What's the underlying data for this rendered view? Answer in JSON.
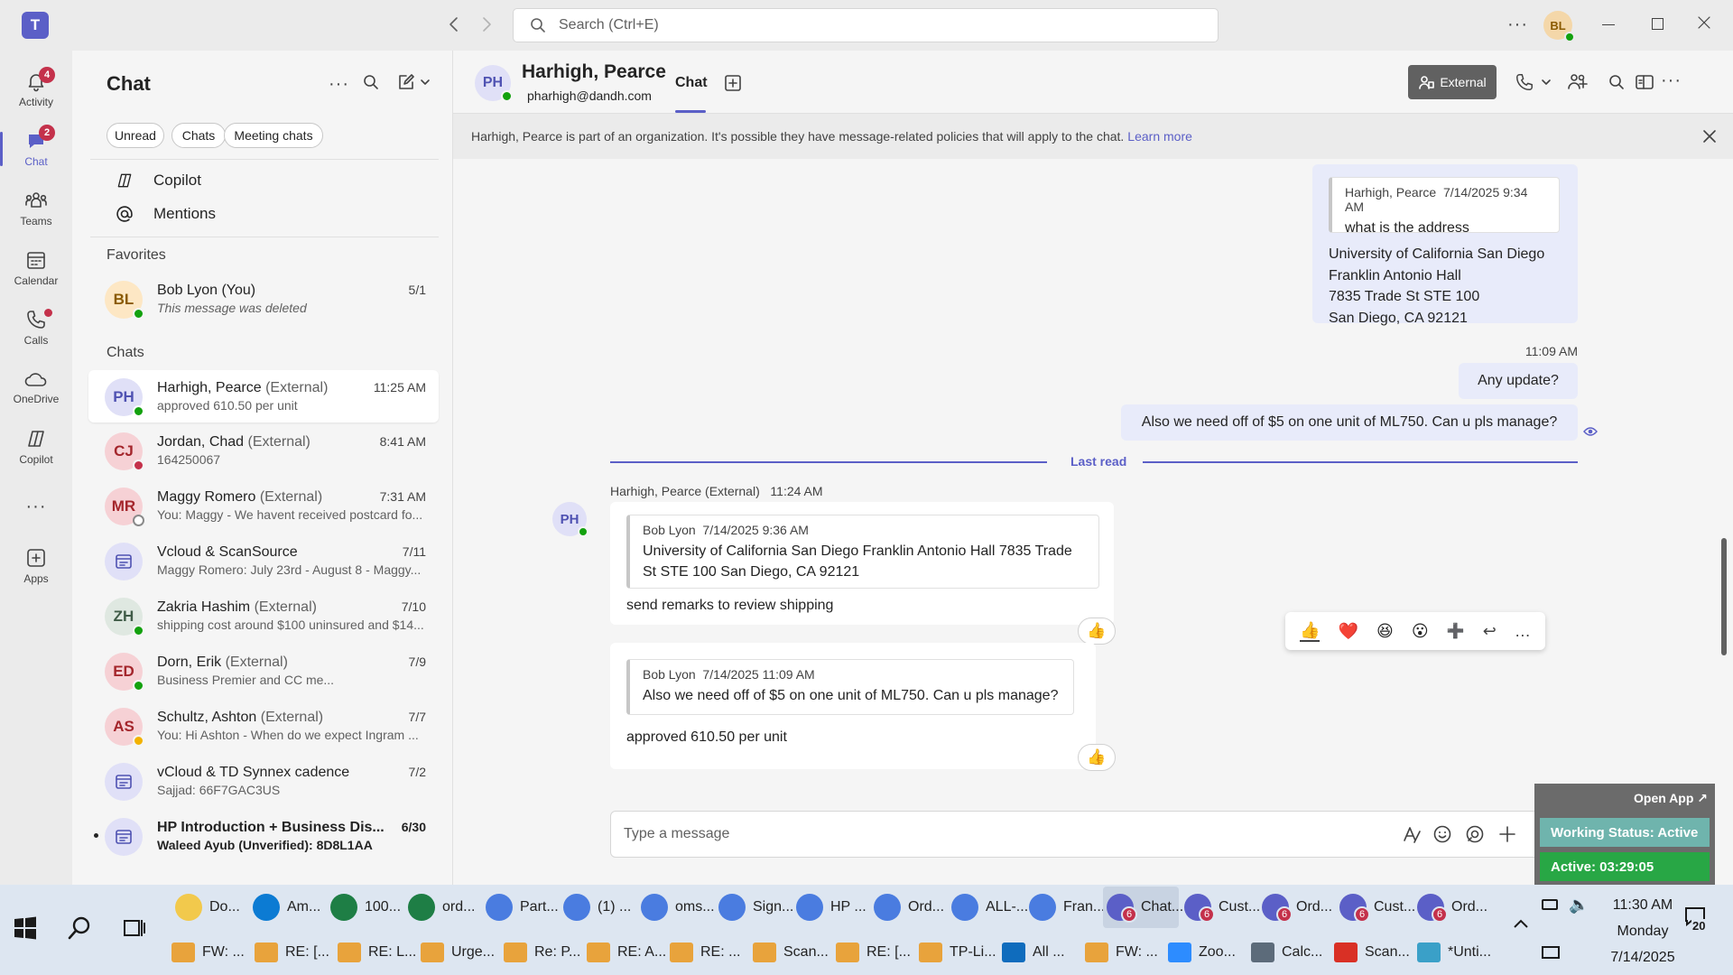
{
  "titlebar": {
    "search_placeholder": "Search (Ctrl+E)",
    "user_initials": "BL"
  },
  "rail": [
    {
      "label": "Activity",
      "badge": "4"
    },
    {
      "label": "Chat",
      "badge": "2"
    },
    {
      "label": "Teams"
    },
    {
      "label": "Calendar"
    },
    {
      "label": "Calls"
    },
    {
      "label": "OneDrive"
    },
    {
      "label": "Copilot"
    },
    {
      "label": "Apps"
    }
  ],
  "chatlist": {
    "title": "Chat",
    "filters": [
      "Unread",
      "Chats",
      "Meeting chats"
    ],
    "nav": [
      "Copilot",
      "Mentions"
    ],
    "favorites_label": "Favorites",
    "chats_label": "Chats",
    "favorites": [
      {
        "initials": "BL",
        "name": "Bob Lyon (You)",
        "external": "",
        "preview": "This message was deleted",
        "time": "5/1"
      }
    ],
    "chats": [
      {
        "initials": "PH",
        "name": "Harhigh, Pearce",
        "external": "(External)",
        "preview": "approved 610.50 per unit",
        "time": "11:25 AM"
      },
      {
        "initials": "CJ",
        "name": "Jordan, Chad",
        "external": "(External)",
        "preview": "164250067",
        "time": "8:41 AM"
      },
      {
        "initials": "MR",
        "name": "Maggy Romero",
        "external": "(External)",
        "preview": "You: Maggy - We havent received postcard fo...",
        "time": "7:31 AM"
      },
      {
        "initials": "",
        "name": "Vcloud & ScanSource",
        "external": "",
        "preview": "Maggy Romero: July 23rd - August 8 - Maggy...",
        "time": "7/11"
      },
      {
        "initials": "ZH",
        "name": "Zakria Hashim",
        "external": "(External)",
        "preview": "shipping cost around $100 uninsured and $14...",
        "time": "7/10"
      },
      {
        "initials": "ED",
        "name": "Dorn, Erik",
        "external": "(External)",
        "preview": "Business Premier and CC me...",
        "time": "7/9"
      },
      {
        "initials": "AS",
        "name": "Schultz, Ashton",
        "external": "(External)",
        "preview": "You: Hi Ashton -  When do we expect Ingram ...",
        "time": "7/7"
      },
      {
        "initials": "",
        "name": "vCloud & TD Synnex cadence",
        "external": "",
        "preview": "Sajjad: 66F7GAC3US",
        "time": "7/2"
      },
      {
        "initials": "",
        "name": "HP Introduction + Business Dis...",
        "external": "",
        "preview": "Waleed Ayub (Unverified): 8D8L1AA",
        "time": "6/30"
      }
    ]
  },
  "header": {
    "initials": "PH",
    "name": "Harhigh, Pearce",
    "email": "pharhigh@dandh.com",
    "tab": "Chat",
    "external_btn": "External"
  },
  "banner": {
    "text": "Harhigh, Pearce is part of an organization. It's possible they have message-related policies that will apply to the chat.",
    "link": "Learn more"
  },
  "messages": {
    "m1": {
      "quote_author": "Harhigh, Pearce",
      "quote_time": "7/14/2025 9:34 AM",
      "quote_text": "what is the address",
      "lines": [
        "University of California San Diego",
        "Franklin Antonio Hall",
        "7835 Trade St STE 100",
        "San Diego, CA 92121"
      ]
    },
    "m2_time": "11:09 AM",
    "m2": "Any update?",
    "m3": "Also we need off of $5 on one unit of ML750. Can u pls manage?",
    "last_read": "Last read",
    "in_header": "Harhigh, Pearce (External)   11:24 AM",
    "in_initials": "PH",
    "in1": {
      "quote_author": "Bob Lyon",
      "quote_time": "7/14/2025 9:36 AM",
      "quote_text": "University of California San Diego Franklin Antonio Hall 7835 Trade St STE 100 San Diego, CA 92121",
      "text": "send remarks to review shipping",
      "reaction": "👍"
    },
    "in2": {
      "quote_author": "Bob Lyon",
      "quote_time": "7/14/2025 11:09 AM",
      "quote_text": "Also we need off of $5 on one unit of ML750. Can u pls manage?",
      "text": "approved 610.50 per unit",
      "reaction": "👍"
    },
    "reaction_bar": [
      "👍",
      "❤️",
      "😆",
      "😮",
      "➕",
      "↩",
      "…"
    ]
  },
  "composer": {
    "placeholder": "Type a message"
  },
  "widget": {
    "open_app": "Open App ↗",
    "status": "Working Status: Active",
    "active": "Active: 03:29:05"
  },
  "taskbar": {
    "row1": [
      {
        "label": "Do...",
        "color": "#f2c94c",
        "num": ""
      },
      {
        "label": "Am...",
        "color": "#0c7bd3",
        "num": ""
      },
      {
        "label": "100...",
        "color": "#1e7e45",
        "num": ""
      },
      {
        "label": "ord...",
        "color": "#1e7e45",
        "num": ""
      },
      {
        "label": "Part...",
        "color": "#4a7ce0",
        "num": ""
      },
      {
        "label": "(1) ...",
        "color": "#4a7ce0",
        "num": ""
      },
      {
        "label": "oms...",
        "color": "#4a7ce0",
        "num": ""
      },
      {
        "label": "Sign...",
        "color": "#4a7ce0",
        "num": ""
      },
      {
        "label": "HP ...",
        "color": "#4a7ce0",
        "num": ""
      },
      {
        "label": "Ord...",
        "color": "#4a7ce0",
        "num": ""
      },
      {
        "label": "ALL-...",
        "color": "#4a7ce0",
        "num": ""
      },
      {
        "label": "Fran...",
        "color": "#4a7ce0",
        "num": ""
      },
      {
        "label": "Chat...",
        "color": "#5b5fc7",
        "num": "6"
      },
      {
        "label": "Cust...",
        "color": "#5b5fc7",
        "num": "6"
      },
      {
        "label": "Ord...",
        "color": "#5b5fc7",
        "num": "6"
      },
      {
        "label": "Cust...",
        "color": "#5b5fc7",
        "num": "6"
      },
      {
        "label": "Ord...",
        "color": "#5b5fc7",
        "num": "6"
      }
    ],
    "row2": [
      {
        "label": "FW: ...",
        "color": "#e8a33c"
      },
      {
        "label": "RE: [...",
        "color": "#e8a33c"
      },
      {
        "label": "RE: L...",
        "color": "#e8a33c"
      },
      {
        "label": "Urge...",
        "color": "#e8a33c"
      },
      {
        "label": "Re: P...",
        "color": "#e8a33c"
      },
      {
        "label": "RE: A...",
        "color": "#e8a33c"
      },
      {
        "label": "RE: ...",
        "color": "#e8a33c"
      },
      {
        "label": "Scan...",
        "color": "#e8a33c"
      },
      {
        "label": "RE: [...",
        "color": "#e8a33c"
      },
      {
        "label": "TP-Li...",
        "color": "#e8a33c"
      },
      {
        "label": "All ...",
        "color": "#0f6cbd"
      },
      {
        "label": "FW: ...",
        "color": "#e8a33c"
      },
      {
        "label": "Zoo...",
        "color": "#2d8cff"
      },
      {
        "label": "Calc...",
        "color": "#5c6b7a"
      },
      {
        "label": "Scan...",
        "color": "#d93025"
      },
      {
        "label": "*Unti...",
        "color": "#3aa0c8"
      }
    ],
    "clock_time": "11:30 AM",
    "clock_day": "Monday",
    "clock_date": "7/14/2025",
    "notif_count": "20"
  }
}
